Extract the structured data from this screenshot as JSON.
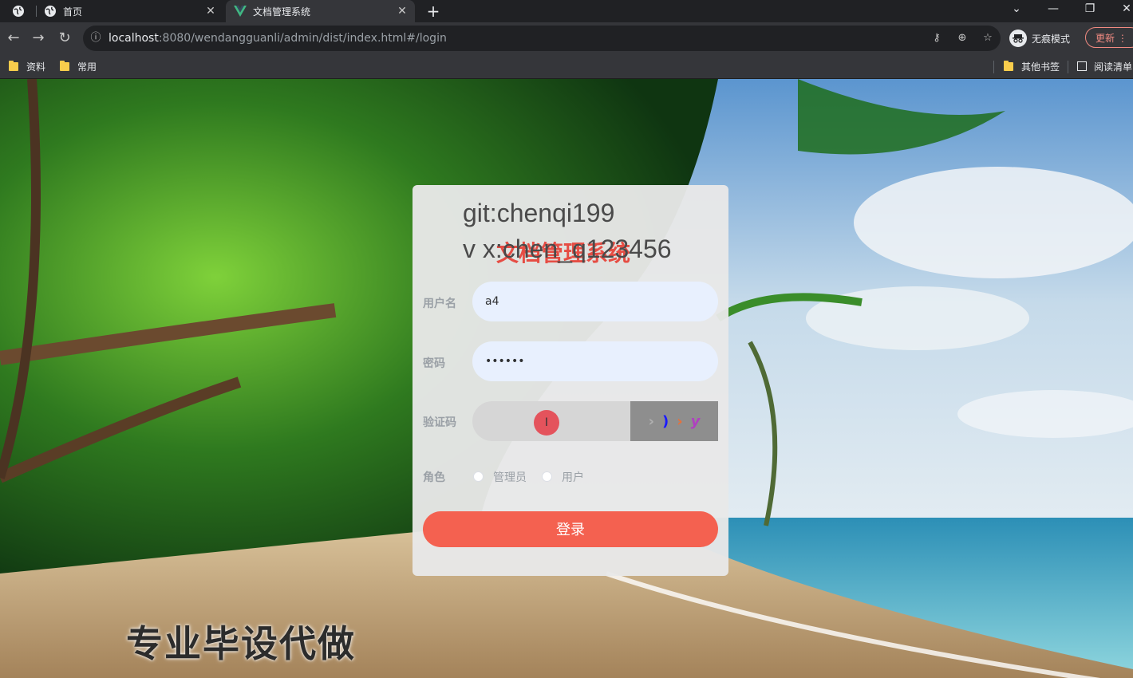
{
  "browser": {
    "tabs": [
      {
        "title": "首页"
      },
      {
        "title": "文档管理系统"
      }
    ],
    "url_host": "localhost",
    "url_rest": ":8080/wendangguanli/admin/dist/index.html#/login",
    "incognito_label": "无痕模式",
    "update_label": "更新",
    "bookmarks": [
      "资料",
      "常用"
    ],
    "bookmarks_right": [
      "其他书签",
      "阅读清单"
    ]
  },
  "watermark": {
    "line1": "git:chenqi199",
    "line2": "v x:chen_q123456"
  },
  "login": {
    "system_title": "文档管理系统",
    "username_label": "用户名",
    "username_value": "a4",
    "password_label": "密码",
    "password_value": "••••••",
    "captcha_label": "验证码",
    "captcha_chars": [
      {
        "ch": "›",
        "color": "#b0b0b0"
      },
      {
        "ch": ")",
        "color": "#1a1aff"
      },
      {
        "ch": "›",
        "color": "#e8703a"
      },
      {
        "ch": "y",
        "color": "#b040c0"
      }
    ],
    "role_label": "角色",
    "roles": [
      "管理员",
      "用户"
    ],
    "login_button": "登录"
  },
  "promo_text": "专业毕设代做",
  "colors": {
    "accent": "#f46150",
    "input_bg": "#e8f0fe"
  }
}
